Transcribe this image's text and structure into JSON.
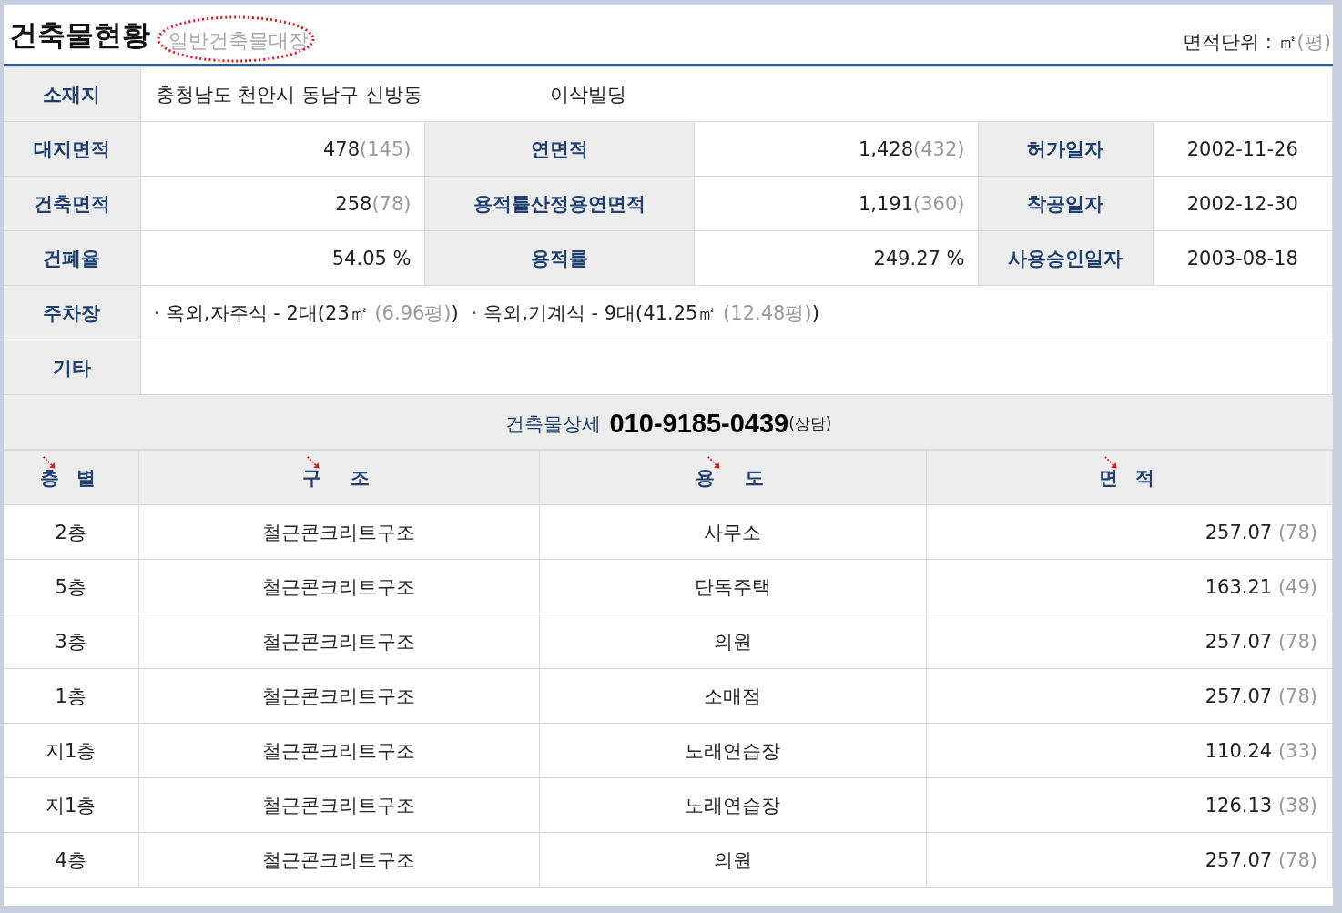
{
  "header": {
    "title": "건축물현황",
    "subtitle": "일반건축물대장",
    "unit_label": "면적단위 : ㎡",
    "unit_sub": "(평)"
  },
  "location": {
    "label": "소재지",
    "address": "충청남도 천안시 동남구 신방동",
    "building_name": "이삭빌딩"
  },
  "grid": [
    [
      {
        "label": "대지면적",
        "value": "478",
        "sub": "(145)"
      },
      {
        "label": "연면적",
        "value": "1,428",
        "sub": "(432)"
      },
      {
        "label": "허가일자",
        "value": "2002-11-26"
      }
    ],
    [
      {
        "label": "건축면적",
        "value": "258",
        "sub": "(78)"
      },
      {
        "label": "용적률산정용연면적",
        "value": "1,191",
        "sub": "(360)"
      },
      {
        "label": "착공일자",
        "value": "2002-12-30"
      }
    ],
    [
      {
        "label": "건폐율",
        "value": "54.05 %"
      },
      {
        "label": "용적률",
        "value": "249.27 %"
      },
      {
        "label": "사용승인일자",
        "value": "2003-08-18"
      }
    ]
  ],
  "parking": {
    "label": "주차장",
    "items": [
      {
        "bullet": "·",
        "main": "옥외,자주식 - 2대(23㎡",
        "sub": "(6.96평)",
        "end": ")"
      },
      {
        "bullet": "·",
        "main": "옥외,기계식 - 9대(41.25㎡",
        "sub": "(12.48평)",
        "end": ")"
      }
    ]
  },
  "etc": {
    "label": "기타"
  },
  "detail": {
    "title": "건축물상세",
    "phone": "010-9185-0439",
    "note": "(상담)"
  },
  "floors": {
    "columns": [
      "층 별",
      "구  조",
      "용  도",
      "면 적"
    ],
    "rows": [
      {
        "floor": "2층",
        "structure": "철근콘크리트구조",
        "use": "사무소",
        "area": "257.07",
        "area_sub": "(78)"
      },
      {
        "floor": "5층",
        "structure": "철근콘크리트구조",
        "use": "단독주택",
        "area": "163.21",
        "area_sub": "(49)"
      },
      {
        "floor": "3층",
        "structure": "철근콘크리트구조",
        "use": "의원",
        "area": "257.07",
        "area_sub": "(78)"
      },
      {
        "floor": "1층",
        "structure": "철근콘크리트구조",
        "use": "소매점",
        "area": "257.07",
        "area_sub": "(78)"
      },
      {
        "floor": "지1층",
        "structure": "철근콘크리트구조",
        "use": "노래연습장",
        "area": "110.24",
        "area_sub": "(33)"
      },
      {
        "floor": "지1층",
        "structure": "철근콘크리트구조",
        "use": "노래연습장",
        "area": "126.13",
        "area_sub": "(38)"
      },
      {
        "floor": "4층",
        "structure": "철근콘크리트구조",
        "use": "의원",
        "area": "257.07",
        "area_sub": "(78)"
      }
    ]
  }
}
